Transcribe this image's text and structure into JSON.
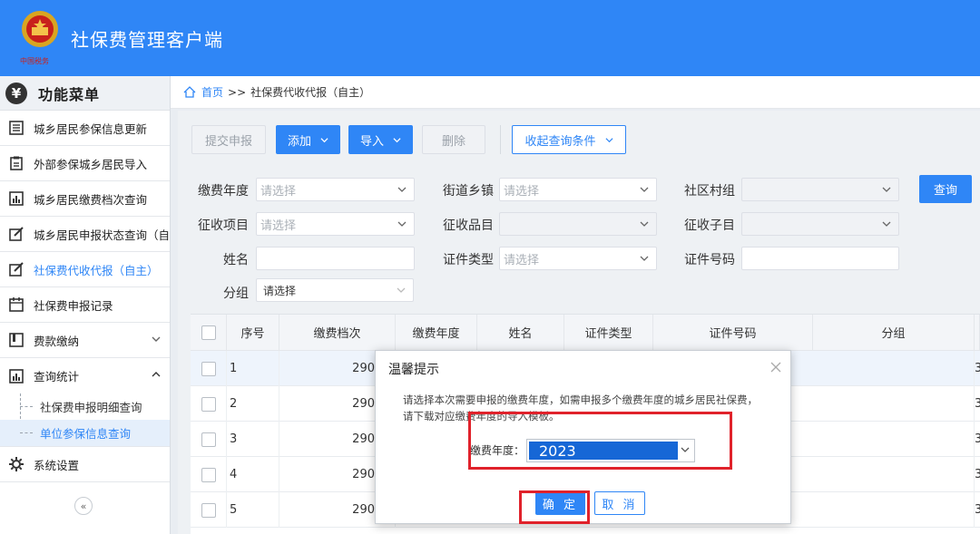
{
  "app": {
    "title": "社保费管理客户端",
    "logo_icon": "tax-emblem-icon"
  },
  "sidebar": {
    "header": "功能菜单",
    "header_icon": "yen-icon",
    "items": [
      {
        "label": "城乡居民参保信息更新",
        "icon": "list-icon"
      },
      {
        "label": "外部参保城乡居民导入",
        "icon": "clipboard-icon"
      },
      {
        "label": "城乡居民缴费档次查询",
        "icon": "bar-chart-icon"
      },
      {
        "label": "城乡居民申报状态查询（自主",
        "icon": "edit-icon"
      },
      {
        "label": "社保费代收代报（自主）",
        "icon": "edit-icon",
        "active": true
      },
      {
        "label": "社保费申报记录",
        "icon": "calendar-icon"
      },
      {
        "label": "费款缴纳",
        "icon": "book-icon"
      },
      {
        "label": "查询统计",
        "icon": "bar-chart-icon"
      }
    ],
    "sub_items": [
      {
        "label": "社保费申报明细查询"
      },
      {
        "label": "单位参保信息查询",
        "active": true
      }
    ],
    "settings": {
      "label": "系统设置",
      "icon": "gear-icon"
    },
    "collapse": "«"
  },
  "breadcrumb": {
    "home": "首页",
    "sep": ">>",
    "current": "社保费代收代报（自主）"
  },
  "toolbar": {
    "submit": "提交申报",
    "add": "添加",
    "import": "导入",
    "delete": "删除",
    "collapse_query": "收起查询条件"
  },
  "filters": {
    "year_label": "缴费年度",
    "year_placeholder": "请选择",
    "street_label": "街道乡镇",
    "street_placeholder": "请选择",
    "village_label": "社区村组",
    "query_button": "查询",
    "item_label": "征收项目",
    "item_placeholder": "请选择",
    "category_label": "征收品目",
    "subitem_label": "征收子目",
    "name_label": "姓名",
    "idtype_label": "证件类型",
    "idtype_placeholder": "请选择",
    "idno_label": "证件号码",
    "group_label": "分组",
    "group_value": "请选择"
  },
  "table": {
    "headers": [
      "序号",
      "缴费档次",
      "缴费年度",
      "姓名",
      "证件类型",
      "证件号码",
      "分组"
    ],
    "rows": [
      {
        "no": "1",
        "tier": "290",
        "tail": "3"
      },
      {
        "no": "2",
        "tier": "290",
        "tail": "3"
      },
      {
        "no": "3",
        "tier": "290",
        "tail": "3"
      },
      {
        "no": "4",
        "tier": "290",
        "tail": "3"
      },
      {
        "no": "5",
        "tier": "290",
        "tail": "3"
      }
    ]
  },
  "dialog": {
    "title": "温馨提示",
    "message": "请选择本次需要申报的缴费年度，如需申报多个缴费年度的城乡居民社保费，请下载对应缴费年度的导入模板。",
    "field_label": "缴费年度：",
    "field_value": "2023",
    "ok": "确 定",
    "cancel": "取 消"
  },
  "colors": {
    "primary": "#2f86f6",
    "header_bg": "#2f86f6",
    "highlight": "#e0222b",
    "selected_option": "#1667d6"
  }
}
